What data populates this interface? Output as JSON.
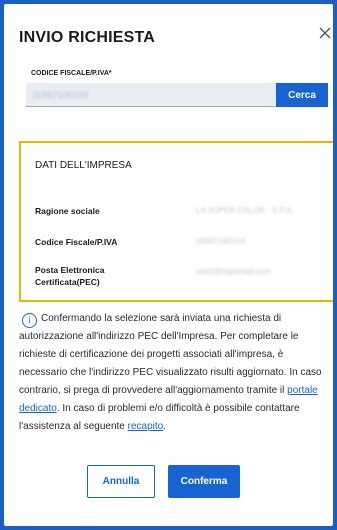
{
  "modal": {
    "title": "INVIO RICHIESTA",
    "close_icon": "close-icon"
  },
  "search": {
    "label": "CODICE FISCALE/P.IVA*",
    "value": "00867190159",
    "button_label": "Cerca"
  },
  "company": {
    "section_title": "DATI DELL'IMPRESA",
    "rows": [
      {
        "label": "Ragione sociale",
        "value": "LA SUPER CALOR - S.P.A."
      },
      {
        "label": "Codice Fiscale/P.IVA",
        "value": "00867190159"
      },
      {
        "label": "Posta Elettronica Certificata(PEC)",
        "value": "test2@legalmail.com"
      }
    ]
  },
  "info": {
    "icon": "info-icon",
    "text_before_link1": "Confermando la selezione sarà inviata una richiesta di autorizzazione all'indirizzo PEC dell'Impresa. Per completare le richieste di certificazione dei progetti associati all'impresa, è necessario che l'indirizzo PEC visualizzato risulti aggiornato. In caso contrario, si prega di provvedere all'aggiornamento tramite il ",
    "link1": "portale dedicato",
    "text_between": ". In caso di problemi e/o difficoltà è possibile contattare l'assistenza al seguente ",
    "link2": "recapito",
    "text_after": "."
  },
  "actions": {
    "cancel_label": "Annulla",
    "confirm_label": "Conferma"
  },
  "colors": {
    "primary": "#1763d1",
    "backdrop": "#1c5fc4",
    "highlight_border": "#f2b400"
  }
}
